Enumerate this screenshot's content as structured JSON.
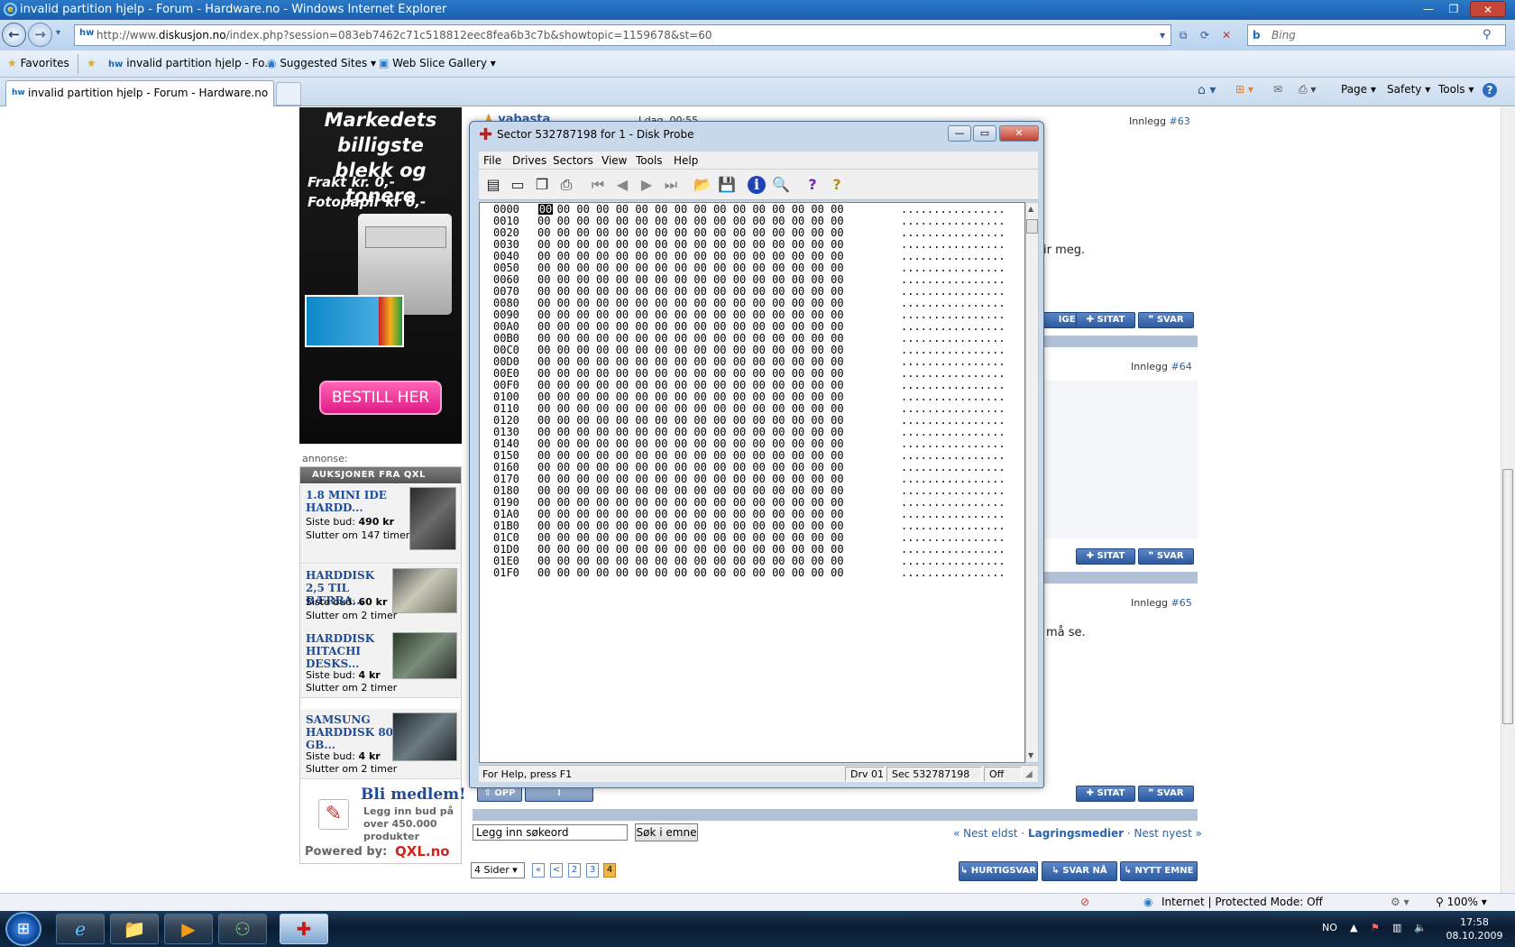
{
  "window": {
    "title": "invalid partition hjelp - Forum - Hardware.no - Windows Internet Explorer"
  },
  "nav": {
    "url_prefix": "http://www.",
    "url_domain": "diskusjon.no",
    "url_rest": "/index.php?session=083eb7462c71c518812eec8fea6b3c7b&showtopic=1159678&st=60",
    "search_placeholder": "Bing"
  },
  "favorites": {
    "favorites_label": "Favorites",
    "fav_item": "invalid partition hjelp - Fo...",
    "suggested": "Suggested Sites ▾",
    "webslice": "Web Slice Gallery ▾"
  },
  "tab": {
    "title": "invalid partition hjelp - Forum - Hardware.no",
    "favicon": "hw"
  },
  "commandbar": {
    "page": "Page ▾",
    "safety": "Safety ▾",
    "tools": "Tools ▾",
    "help": "?"
  },
  "ad": {
    "heading_1": "Markedets billigste",
    "heading_2": "blekk og tonere",
    "line_1": "Frakt kr. 0,-",
    "line_2": "Fotopapir kr 0,-",
    "button": "BESTILL HER",
    "annonse": "annonse:"
  },
  "qxl": {
    "header": "AUKSJONER FRA QXL",
    "items": [
      {
        "title": "1.8 MINI IDE HARDD...",
        "bid_label": "Siste bud:",
        "bid": "490 kr",
        "ends": "Slutter om 147 timer"
      },
      {
        "title": "HARDDISK 2,5 TIL BÆRBA...",
        "bid_label": "Siste bud:",
        "bid": "60 kr",
        "ends": "Slutter om 2 timer"
      },
      {
        "title": "HARDDISK HITACHI DESKS...",
        "bid_label": "Siste bud:",
        "bid": "4 kr",
        "ends": "Slutter om 2 timer"
      },
      {
        "title": "SAMSUNG HARDDISK 80 GB...",
        "bid_label": "Siste bud:",
        "bid": "4 kr",
        "ends": "Slutter om 2 timer"
      }
    ],
    "member_title": "Bli medlem!",
    "member_text_1": "Legg inn bud på",
    "member_text_2": "over 450.000",
    "member_text_3": "produkter",
    "powered": "Powered by:",
    "logo": "QXL.no"
  },
  "forum": {
    "post1_user": "vabasta",
    "post1_time": "I dag, 00:55",
    "post1_innlegg": "Innlegg",
    "post1_num": "#63",
    "post1_text": "ir meg.",
    "post2_innlegg": "Innlegg",
    "post2_num": "#64",
    "post3_innlegg": "Innlegg",
    "post3_num": "#65",
    "post3_text": "må se.",
    "btn_endringer": "IGER",
    "btn_sitat": "SITAT",
    "btn_svar": "SVAR",
    "btn_opp": "OPP",
    "btn_rapporter": "RAPPORTER",
    "search_value": "Legg inn søkeord",
    "search_button": "Søk i emne",
    "nest_eldst": "« Nest eldst",
    "sep": " · ",
    "lagring": "Lagringsmedier",
    "nest_nyest": "Nest nyest »",
    "sider": "4 Sider ▾",
    "pages": [
      "«",
      "<",
      "2",
      "3",
      "4"
    ],
    "btn_hurtigsvar": "HURTIGSVAR",
    "btn_svar_na": "SVAR NÅ",
    "btn_nytt_emne": "NYTT EMNE"
  },
  "diskprobe": {
    "title": "Sector 532787198 for 1 - Disk Probe",
    "menu": [
      "File",
      "Drives",
      "Sectors",
      "View",
      "Tools",
      "Help"
    ],
    "cursor_byte": "00",
    "bytes_row": "00 00 00 00 00 00 00 00 00 00 00 00 00 00 00 00",
    "ascii_row": "................",
    "offsets": [
      "0000",
      "0010",
      "0020",
      "0030",
      "0040",
      "0050",
      "0060",
      "0070",
      "0080",
      "0090",
      "00A0",
      "00B0",
      "00C0",
      "00D0",
      "00E0",
      "00F0",
      "0100",
      "0110",
      "0120",
      "0130",
      "0140",
      "0150",
      "0160",
      "0170",
      "0180",
      "0190",
      "01A0",
      "01B0",
      "01C0",
      "01D0",
      "01E0",
      "01F0"
    ],
    "status_help": "For Help, press F1",
    "status_drv": "Drv  01",
    "status_sec": "Sec 532787198",
    "status_off": "Off"
  },
  "iestatus": {
    "zone": "Internet | Protected Mode: Off",
    "zoom": "100%"
  },
  "taskbar": {
    "lang": "NO",
    "time": "17:58",
    "date": "08.10.2009"
  },
  "colors": {
    "accent": "#2c5aa0",
    "link": "#2a63ad",
    "ad_pink": "#e01b86",
    "qxl_red": "#d3241a"
  }
}
